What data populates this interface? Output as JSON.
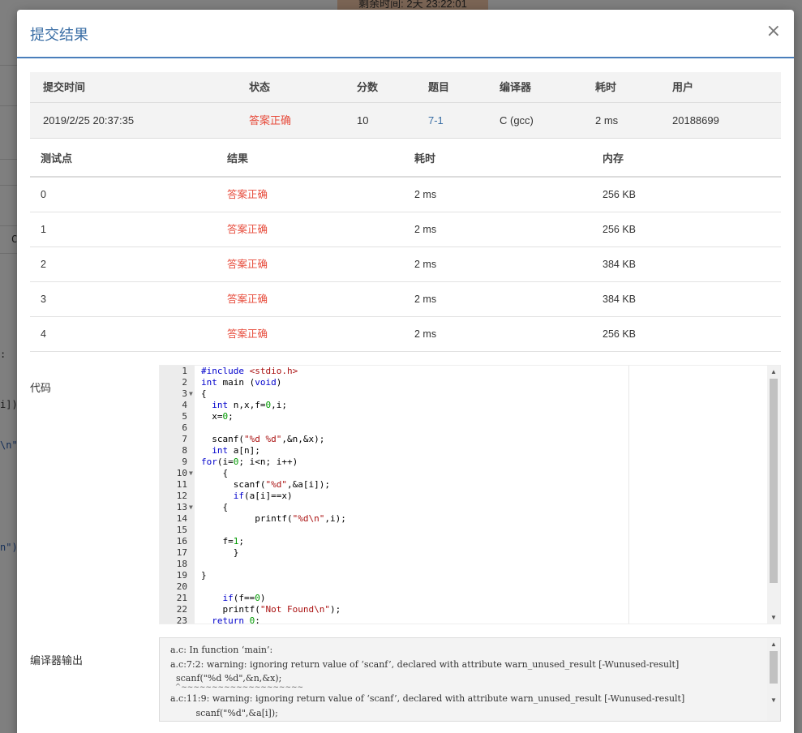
{
  "background": {
    "timer_text": "剩余时间: 2天 23:22:01",
    "code_fragments": [
      ":",
      "i])",
      "\\n\"",
      "n\")",
      "C"
    ]
  },
  "modal": {
    "title": "提交结果",
    "close_icon": "×"
  },
  "summary": {
    "headers": [
      "提交时间",
      "状态",
      "分数",
      "题目",
      "编译器",
      "耗时",
      "用户"
    ],
    "row": {
      "time": "2019/2/25 20:37:35",
      "status": "答案正确",
      "score": "10",
      "problem": "7-1",
      "compiler": "C (gcc)",
      "duration": "2 ms",
      "user": "20188699"
    }
  },
  "cases": {
    "headers": [
      "测试点",
      "结果",
      "耗时",
      "内存"
    ],
    "rows": [
      {
        "id": "0",
        "result": "答案正确",
        "time": "2 ms",
        "memory": "256 KB"
      },
      {
        "id": "1",
        "result": "答案正确",
        "time": "2 ms",
        "memory": "256 KB"
      },
      {
        "id": "2",
        "result": "答案正确",
        "time": "2 ms",
        "memory": "384 KB"
      },
      {
        "id": "3",
        "result": "答案正确",
        "time": "2 ms",
        "memory": "384 KB"
      },
      {
        "id": "4",
        "result": "答案正确",
        "time": "2 ms",
        "memory": "256 KB"
      }
    ]
  },
  "code": {
    "label": "代码",
    "lines": [
      {
        "n": "1",
        "fold": false,
        "text": "#include <stdio.h>"
      },
      {
        "n": "2",
        "fold": false,
        "text": "int main (void)"
      },
      {
        "n": "3",
        "fold": true,
        "text": "{"
      },
      {
        "n": "4",
        "fold": false,
        "text": "  int n,x,f=0,i;"
      },
      {
        "n": "5",
        "fold": false,
        "text": "  x=0;"
      },
      {
        "n": "6",
        "fold": false,
        "text": ""
      },
      {
        "n": "7",
        "fold": false,
        "text": "  scanf(\"%d %d\",&n,&x);"
      },
      {
        "n": "8",
        "fold": false,
        "text": "  int a[n];"
      },
      {
        "n": "9",
        "fold": false,
        "text": "for(i=0; i<n; i++)"
      },
      {
        "n": "10",
        "fold": true,
        "text": "    {"
      },
      {
        "n": "11",
        "fold": false,
        "text": "      scanf(\"%d\",&a[i]);"
      },
      {
        "n": "12",
        "fold": false,
        "text": "      if(a[i]==x)"
      },
      {
        "n": "13",
        "fold": true,
        "text": "    {"
      },
      {
        "n": "14",
        "fold": false,
        "text": "          printf(\"%d\\n\",i);"
      },
      {
        "n": "15",
        "fold": false,
        "text": ""
      },
      {
        "n": "16",
        "fold": false,
        "text": "    f=1;"
      },
      {
        "n": "17",
        "fold": false,
        "text": "      }"
      },
      {
        "n": "18",
        "fold": false,
        "text": ""
      },
      {
        "n": "19",
        "fold": false,
        "text": "}"
      },
      {
        "n": "20",
        "fold": false,
        "text": ""
      },
      {
        "n": "21",
        "fold": false,
        "text": "    if(f==0)"
      },
      {
        "n": "22",
        "fold": false,
        "text": "    printf(\"Not Found\\n\");"
      },
      {
        "n": "23",
        "fold": false,
        "text": "  return 0;"
      }
    ]
  },
  "compiler_output": {
    "label": "编译器输出",
    "lines": [
      "a.c: In function ‘main’:",
      "a.c:7:2: warning: ignoring return value of ‘scanf’, declared with attribute warn_unused_result [-Wunused-result]",
      "  scanf(\"%d %d\",&n,&x);",
      "  ^~~~~~~~~~~~~~~~~~~~~",
      "a.c:11:9: warning: ignoring return value of ‘scanf’, declared with attribute warn_unused_result [-Wunused-result]",
      "         scanf(\"%d\",&a[i]);"
    ]
  },
  "colors": {
    "accent": "#3a6ea5",
    "success": "#e74c3c"
  }
}
